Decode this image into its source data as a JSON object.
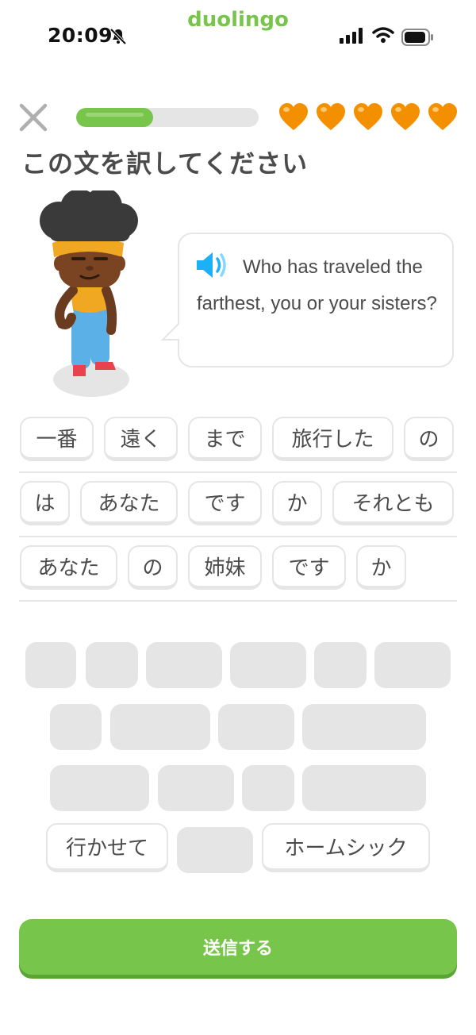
{
  "status_bar": {
    "time": "20:09",
    "brand": "duolingo"
  },
  "header": {
    "progress_fraction": 0.42,
    "hearts_count": 5,
    "colors": {
      "accent": "#77c54a",
      "heart": "#f49000"
    }
  },
  "prompt": "この文を訳してください",
  "sentence": "Who has traveled the farthest, you or your sisters?",
  "icons": [
    "close-icon",
    "heart-icon",
    "speaker-icon",
    "bell-slash-icon",
    "signal-icon",
    "wifi-icon",
    "battery-icon"
  ],
  "answer_rows": [
    [
      "一番",
      "遠く",
      "まで",
      "旅行した",
      "の"
    ],
    [
      "は",
      "あなた",
      "です",
      "か",
      "それとも"
    ],
    [
      "あなた",
      "の",
      "姉妹",
      "です",
      "か"
    ]
  ],
  "bank": {
    "remaining": [
      "行かせて",
      "ホームシック"
    ]
  },
  "submit_label": "送信する"
}
